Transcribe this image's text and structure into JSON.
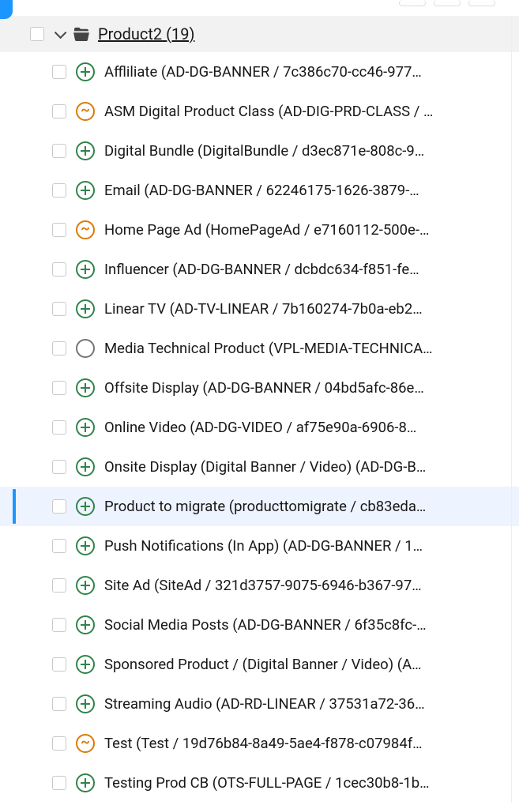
{
  "header": {
    "label": "Product2 (19)"
  },
  "items": [
    {
      "status": "add",
      "label": "Affliliate (AD-DG-BANNER / 7c386c70-cc46-977…",
      "selected": false
    },
    {
      "status": "sync",
      "label": "ASM Digital Product Class (AD-DIG-PRD-CLASS / …",
      "selected": false
    },
    {
      "status": "add",
      "label": "Digital Bundle (DigitalBundle / d3ec871e-808c-9…",
      "selected": false
    },
    {
      "status": "add",
      "label": "Email (AD-DG-BANNER / 62246175-1626-3879-…",
      "selected": false
    },
    {
      "status": "sync",
      "label": "Home Page Ad (HomePageAd / e7160112-500e-…",
      "selected": false
    },
    {
      "status": "add",
      "label": "Influencer (AD-DG-BANNER / dcbdc634-f851-fe…",
      "selected": false
    },
    {
      "status": "add",
      "label": "Linear TV (AD-TV-LINEAR / 7b160274-7b0a-eb2…",
      "selected": false
    },
    {
      "status": "neutral",
      "label": "Media Technical Product (VPL-MEDIA-TECHNICA…",
      "selected": false
    },
    {
      "status": "add",
      "label": "Offsite Display (AD-DG-BANNER / 04bd5afc-86e…",
      "selected": false
    },
    {
      "status": "add",
      "label": "Online Video (AD-DG-VIDEO / af75e90a-6906-8…",
      "selected": false
    },
    {
      "status": "add",
      "label": "Onsite Display (Digital Banner / Video) (AD-DG-B…",
      "selected": false
    },
    {
      "status": "add",
      "label": "Product to migrate (producttomigrate / cb83eda…",
      "selected": true
    },
    {
      "status": "add",
      "label": "Push Notifications (In App) (AD-DG-BANNER / 1…",
      "selected": false
    },
    {
      "status": "add",
      "label": "Site Ad (SiteAd / 321d3757-9075-6946-b367-97…",
      "selected": false
    },
    {
      "status": "add",
      "label": "Social Media Posts (AD-DG-BANNER / 6f35c8fc-…",
      "selected": false
    },
    {
      "status": "add",
      "label": "Sponsored Product / (Digital Banner / Video) (A…",
      "selected": false
    },
    {
      "status": "add",
      "label": "Streaming Audio (AD-RD-LINEAR / 37531a72-36…",
      "selected": false
    },
    {
      "status": "sync",
      "label": "Test (Test / 19d76b84-8a49-5ae4-f878-c07984f…",
      "selected": false
    },
    {
      "status": "add",
      "label": "Testing Prod CB (OTS-FULL-PAGE / 1cec30b8-1b…",
      "selected": false
    }
  ]
}
